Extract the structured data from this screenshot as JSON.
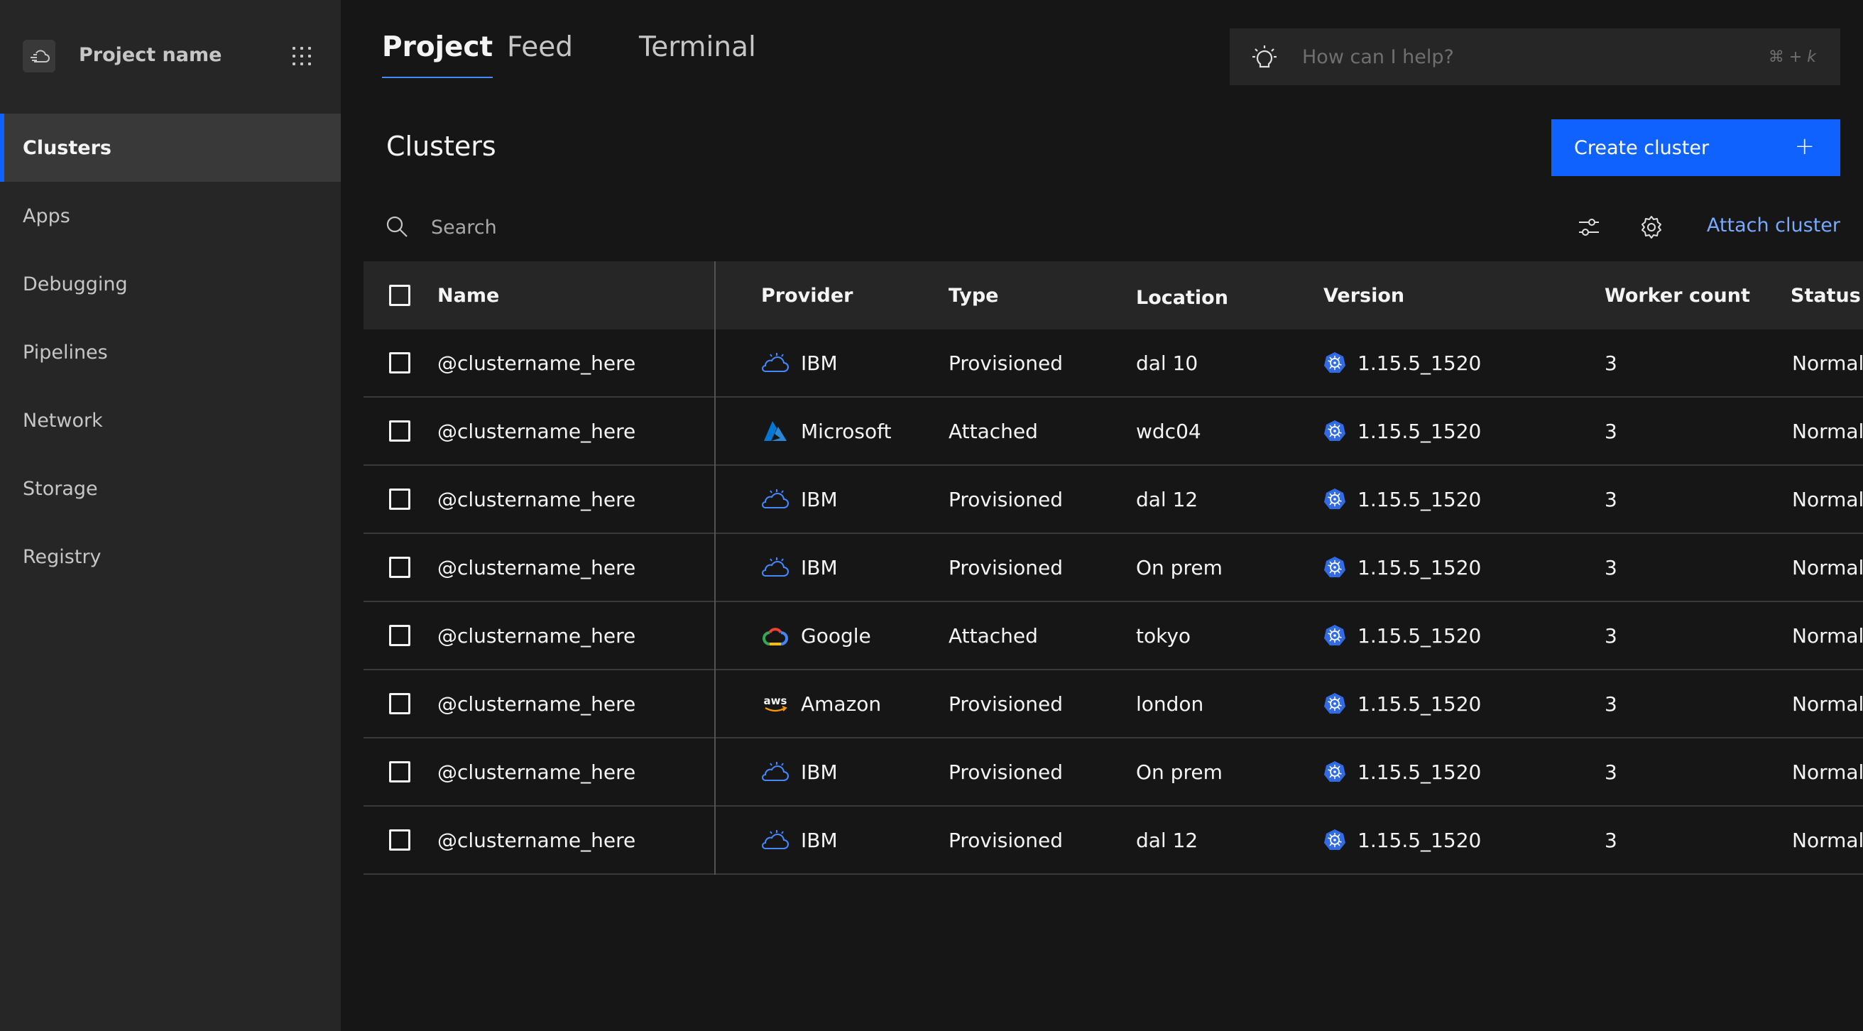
{
  "sidebar": {
    "project_name": "Project name",
    "items": [
      {
        "label": "Clusters",
        "active": true
      },
      {
        "label": "Apps"
      },
      {
        "label": "Debugging"
      },
      {
        "label": "Pipelines"
      },
      {
        "label": "Network"
      },
      {
        "label": "Storage"
      },
      {
        "label": "Registry"
      }
    ]
  },
  "tabs": [
    {
      "label": "Project",
      "active": true
    },
    {
      "label": "Feed"
    },
    {
      "label": "Terminal"
    }
  ],
  "assistant": {
    "placeholder": "How can I help?",
    "shortcut": "⌘ + k"
  },
  "page": {
    "title": "Clusters",
    "create_label": "Create cluster",
    "create_icon": "+"
  },
  "toolbar": {
    "search_placeholder": "Search",
    "attach_label": "Attach cluster"
  },
  "table": {
    "columns": [
      "Name",
      "Provider",
      "Type",
      "Location",
      "Version",
      "Worker count",
      "Status"
    ],
    "rows": [
      {
        "name": "@clustername_here",
        "provider": "IBM",
        "provider_icon": "ibm-cloud-icon",
        "type": "Provisioned",
        "location": "dal 10",
        "version": "1.15.5_1520",
        "workers": "3",
        "status": "Normal"
      },
      {
        "name": "@clustername_here",
        "provider": "Microsoft",
        "provider_icon": "azure-icon",
        "type": "Attached",
        "location": "wdc04",
        "version": "1.15.5_1520",
        "workers": "3",
        "status": "Normal"
      },
      {
        "name": "@clustername_here",
        "provider": "IBM",
        "provider_icon": "ibm-cloud-icon",
        "type": "Provisioned",
        "location": "dal 12",
        "version": "1.15.5_1520",
        "workers": "3",
        "status": "Normal"
      },
      {
        "name": "@clustername_here",
        "provider": "IBM",
        "provider_icon": "ibm-cloud-icon",
        "type": "Provisioned",
        "location": "On prem",
        "version": "1.15.5_1520",
        "workers": "3",
        "status": "Normal"
      },
      {
        "name": "@clustername_here",
        "provider": "Google",
        "provider_icon": "google-cloud-icon",
        "type": "Attached",
        "location": "tokyo",
        "version": "1.15.5_1520",
        "workers": "3",
        "status": "Normal"
      },
      {
        "name": "@clustername_here",
        "provider": "Amazon",
        "provider_icon": "aws-icon",
        "type": "Provisioned",
        "location": "london",
        "version": "1.15.5_1520",
        "workers": "3",
        "status": "Normal"
      },
      {
        "name": "@clustername_here",
        "provider": "IBM",
        "provider_icon": "ibm-cloud-icon",
        "type": "Provisioned",
        "location": "On prem",
        "version": "1.15.5_1520",
        "workers": "3",
        "status": "Normal"
      },
      {
        "name": "@clustername_here",
        "provider": "IBM",
        "provider_icon": "ibm-cloud-icon",
        "type": "Provisioned",
        "location": "dal 12",
        "version": "1.15.5_1520",
        "workers": "3",
        "status": "Normal"
      }
    ]
  },
  "colors": {
    "accent": "#0f62fe",
    "link": "#78a9ff",
    "background": "#161616",
    "sidebar": "#262626",
    "kubernetes": "#326ce5"
  }
}
